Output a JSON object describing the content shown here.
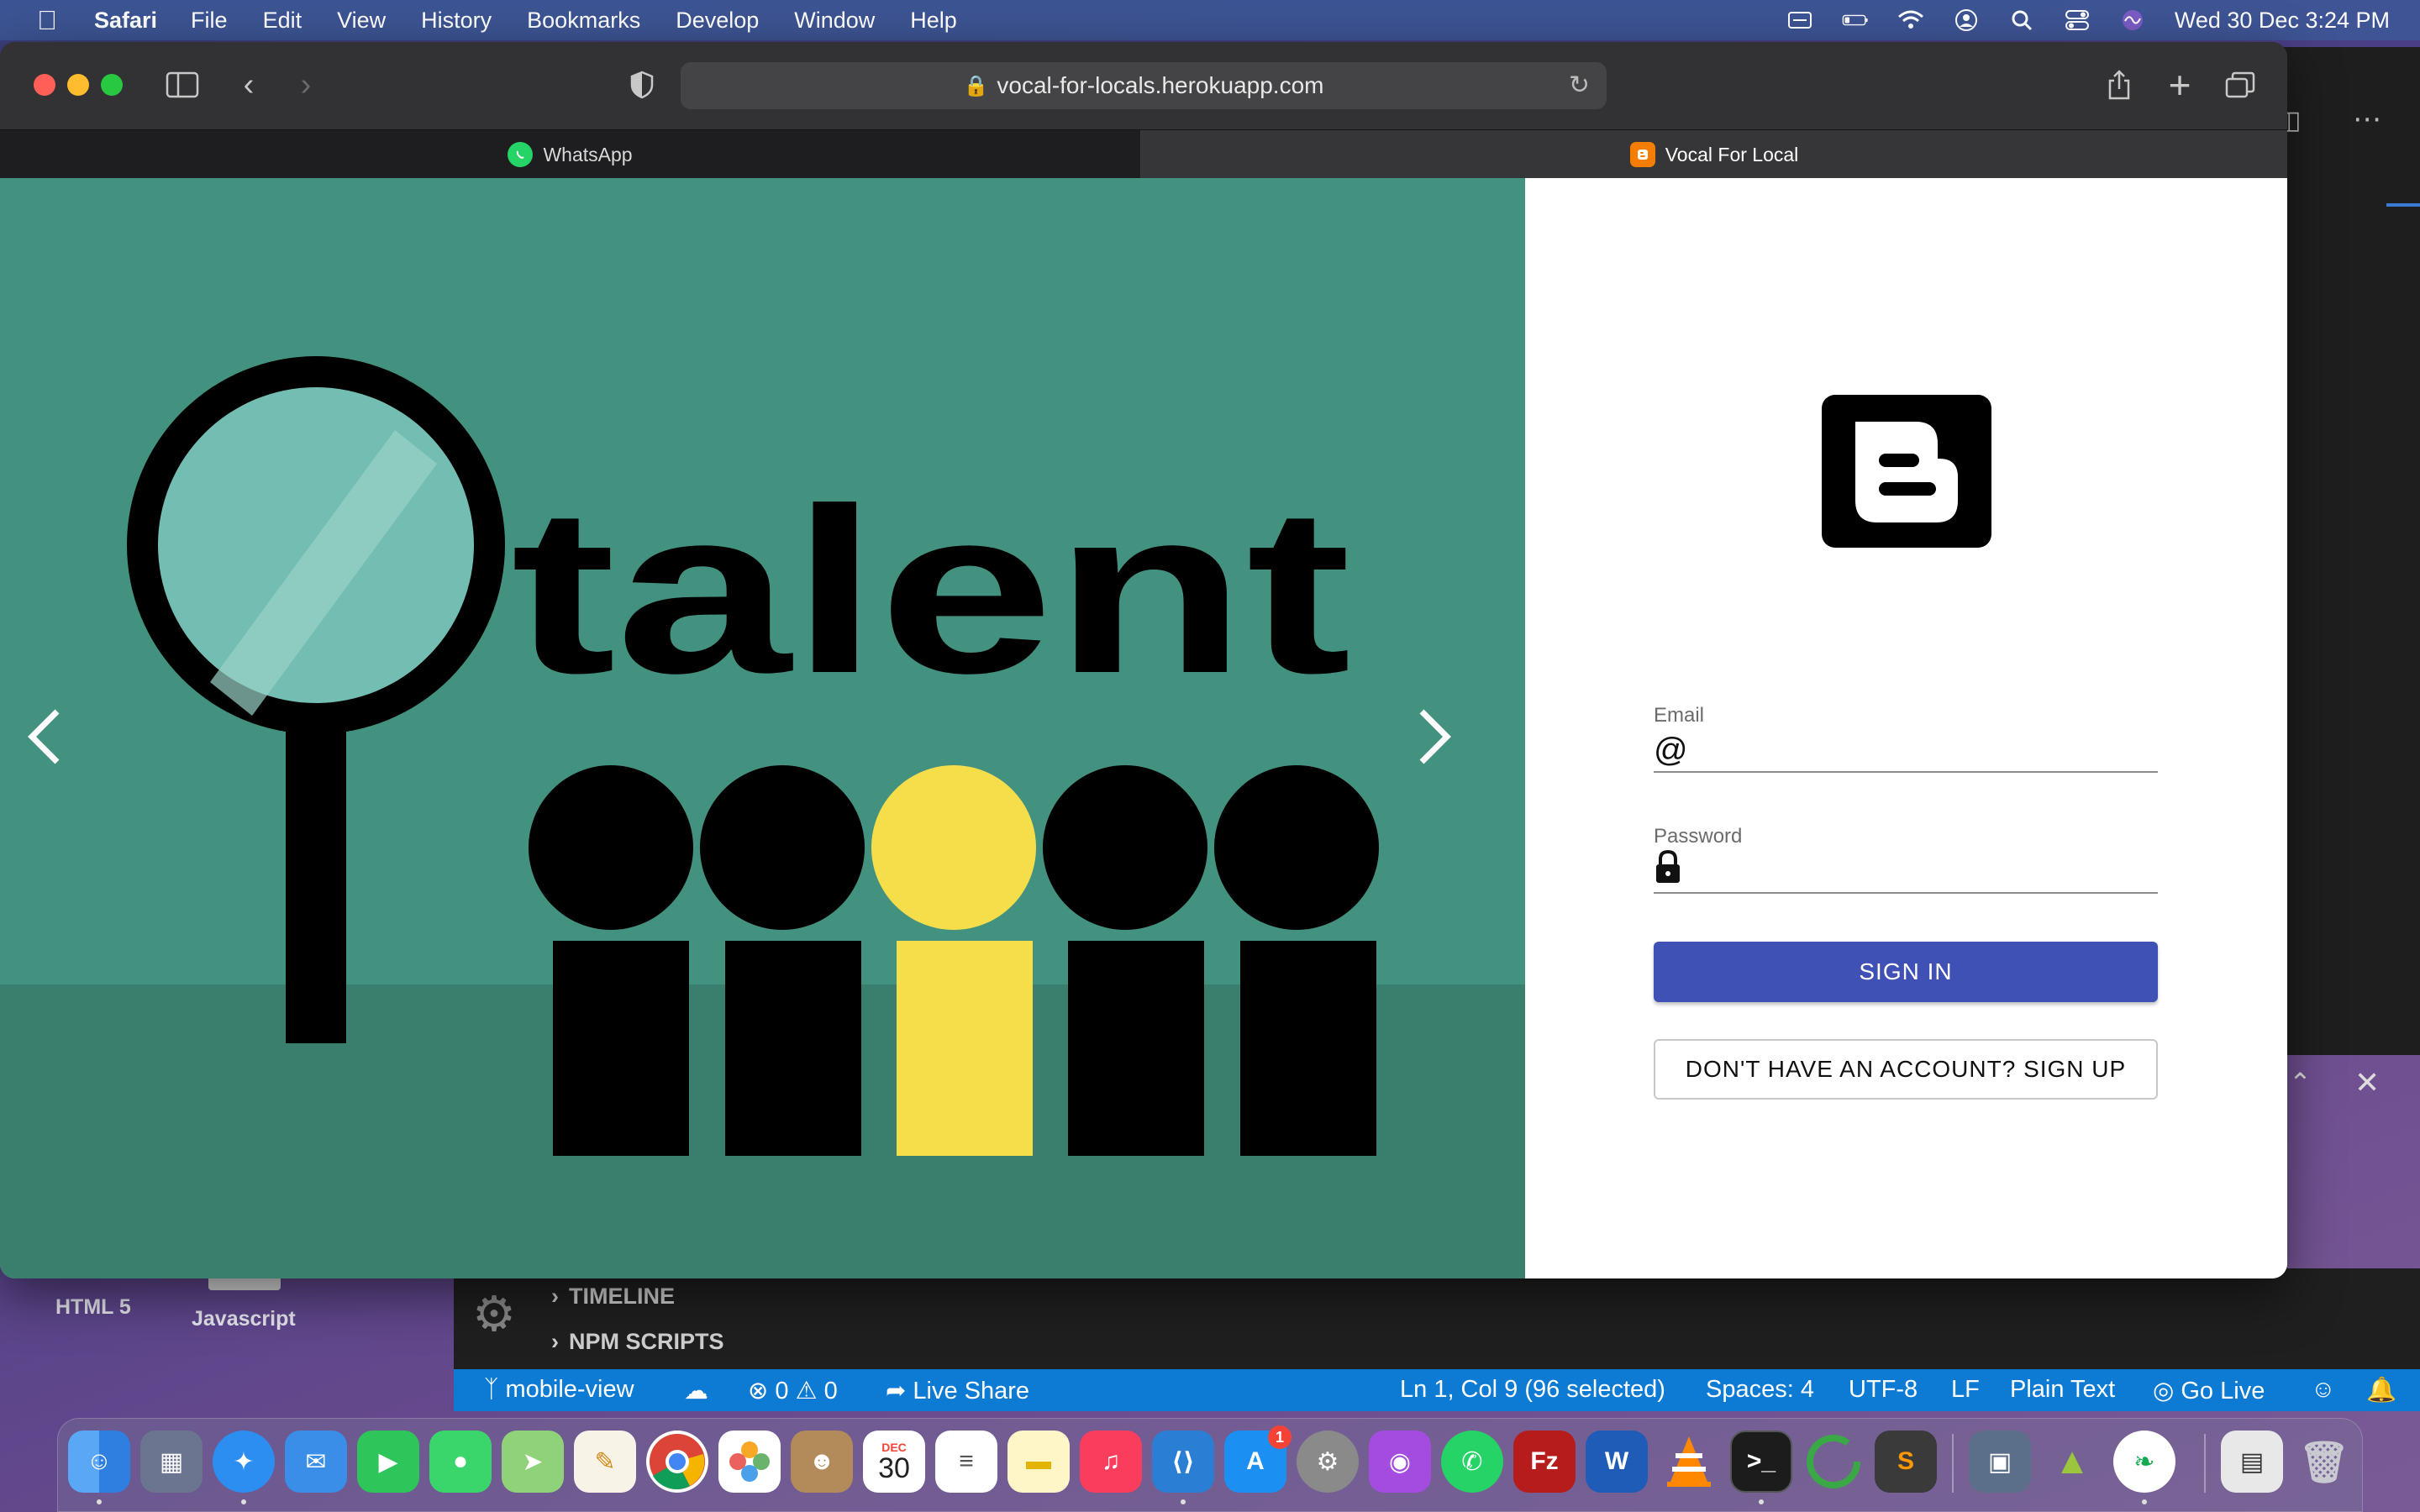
{
  "menubar": {
    "app_name": "Safari",
    "items": [
      "File",
      "Edit",
      "View",
      "History",
      "Bookmarks",
      "Develop",
      "Window",
      "Help"
    ],
    "clock": "Wed 30 Dec  3:24 PM"
  },
  "browser": {
    "url": "vocal-for-locals.herokuapp.com",
    "tabs": [
      {
        "label": "WhatsApp"
      },
      {
        "label": "Vocal For Local"
      }
    ]
  },
  "hero": {
    "image_text": "talent"
  },
  "login": {
    "email_label": "Email",
    "password_label": "Password",
    "signin_label": "SIGN IN",
    "signup_label": "DON'T HAVE AN ACCOUNT? SIGN UP"
  },
  "vscode": {
    "sections": [
      "TIMELINE",
      "NPM SCRIPTS"
    ],
    "status": {
      "branch": "mobile-view",
      "errors": "0",
      "warnings": "0",
      "live_share": "Live Share",
      "cursor": "Ln 1, Col 9 (96 selected)",
      "spaces": "Spaces: 4",
      "encoding": "UTF-8",
      "eol": "LF",
      "language": "Plain Text",
      "go_live": "Go Live"
    }
  },
  "desktop": {
    "icons": [
      "HTML 5",
      "Javascript"
    ]
  },
  "dock": {
    "calendar_month": "DEC",
    "calendar_day": "30",
    "appstore_badge": "1",
    "word_letter": "W",
    "filezilla_letter": "Fz"
  },
  "colors": {
    "accent": "#3f51b5",
    "carousel_bg": "#43917f",
    "statusbar": "#0d7ad3"
  }
}
